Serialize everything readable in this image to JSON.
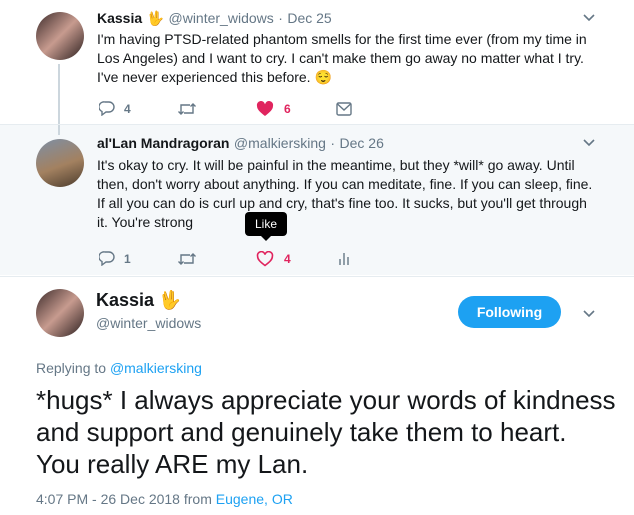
{
  "tweet1": {
    "name": "Kassia",
    "handle": "@winter_widows",
    "date": "Dec 25",
    "text": "I'm having PTSD-related phantom smells for the first time ever (from my time in Los Angeles) and I want to cry. I can't make them go away no matter what I try. I've never experienced this before. 😌",
    "reply_count": "4",
    "like_count": "6",
    "icons": [
      "reply-icon",
      "retweet-icon",
      "heart-filled-icon",
      "message-icon",
      "caret-down-icon"
    ]
  },
  "tweet2": {
    "name": "al'Lan Mandragoran",
    "handle": "@malkiersking",
    "date": "Dec 26",
    "text_before": "It's okay to cry. It will be painful in the meantime, but they *will* go away. Until then, don't worry about anything. If you can meditate, fine. If you can sleep, fine. If all you can do is ",
    "text_hidden": "curl up",
    "text_after": " and cry, that's fine too. It sucks, but you'll get through it. You're strong",
    "reply_count": "1",
    "like_count": "4",
    "tooltip": "Like",
    "icons": [
      "reply-icon",
      "retweet-icon",
      "heart-outline-icon",
      "analytics-icon",
      "caret-down-icon"
    ]
  },
  "main": {
    "name": "Kassia",
    "handle": "@winter_widows",
    "follow_label": "Following",
    "replying_prefix": "Replying to ",
    "replying_to": "@malkiersking",
    "text": "*hugs* I always appreciate your words of kindness and support and genuinely take them to heart. You really ARE my Lan.",
    "timestamp": "4:07 PM - 26 Dec 2018 from ",
    "location": "Eugene, OR"
  },
  "colors": {
    "accent": "#1da1f2",
    "like": "#e0245e",
    "muted": "#657786",
    "reply_bg": "#f5f8fa"
  }
}
